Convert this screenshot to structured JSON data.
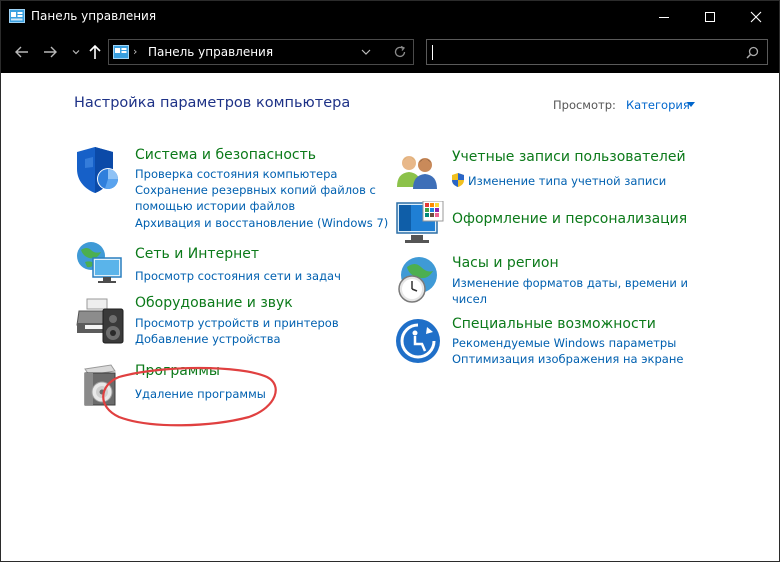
{
  "window": {
    "title": "Панель управления"
  },
  "address": {
    "crumb": "Панель управления",
    "search_value": ""
  },
  "content": {
    "heading": "Настройка параметров компьютера",
    "view_by_label": "Просмотр:",
    "view_by_value": "Категория"
  },
  "left_categories": [
    {
      "title": "Система и безопасность",
      "links": [
        "Проверка состояния компьютера",
        "Сохранение резервных копий файлов с",
        "помощью истории файлов",
        "Архивация и восстановление (Windows 7)"
      ]
    },
    {
      "title": "Сеть и Интернет",
      "links": [
        "Просмотр состояния сети и задач"
      ]
    },
    {
      "title": "Оборудование и звук",
      "links": [
        "Просмотр устройств и принтеров",
        "Добавление устройства"
      ]
    },
    {
      "title": "Программы",
      "links": [
        "Удаление программы"
      ]
    }
  ],
  "right_categories": [
    {
      "title": "Учетные записи пользователей",
      "links": [
        "Изменение типа учетной записи"
      ]
    },
    {
      "title": "Оформление и персонализация",
      "links": []
    },
    {
      "title": "Часы и регион",
      "links": [
        "Изменение форматов даты, времени и",
        "чисел"
      ]
    },
    {
      "title": "Специальные возможности",
      "links": [
        "Рекомендуемые Windows параметры",
        "Оптимизация изображения на экране"
      ]
    }
  ],
  "colors": {
    "heading": "#1e3287",
    "category_title": "#0c7a1a",
    "link": "#0060b0",
    "annotation": "#e04040"
  }
}
